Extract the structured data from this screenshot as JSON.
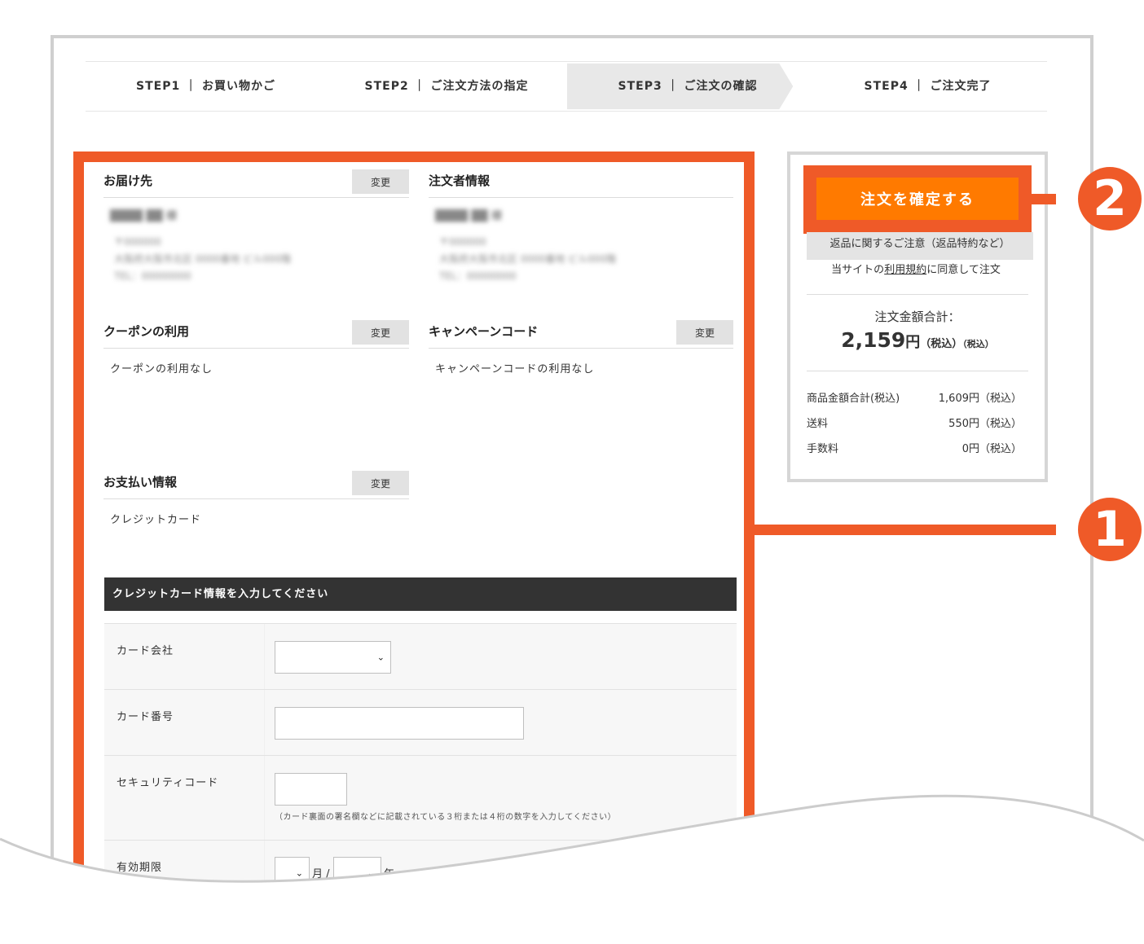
{
  "steps": [
    {
      "label": "STEP1 ｜ お買い物かご"
    },
    {
      "label": "STEP2 ｜ ご注文方法の指定"
    },
    {
      "label": "STEP3 ｜ ご注文の確認"
    },
    {
      "label": "STEP4 ｜ ご注文完了"
    }
  ],
  "sections": {
    "delivery": {
      "title": "お届け先",
      "change": "変更",
      "name": "████ ██ 様",
      "address": [
        "〒000000",
        "大阪府大阪市北区 0000番地 ビル000階",
        "TEL：00000000"
      ]
    },
    "orderer": {
      "title": "注文者情報",
      "name": "████ ██ 様",
      "address": [
        "〒000000",
        "大阪府大阪市北区 0000番地 ビル000階",
        "TEL：00000000"
      ]
    },
    "coupon": {
      "title": "クーポンの利用",
      "change": "変更",
      "value": "クーポンの利用なし"
    },
    "campaign": {
      "title": "キャンペーンコード",
      "change": "変更",
      "value": "キャンペーンコードの利用なし"
    },
    "payment": {
      "title": "お支払い情報",
      "change": "変更",
      "value": "クレジットカード"
    }
  },
  "credit_card": {
    "header": "クレジットカード情報を入力してください",
    "card_company_label": "カード会社",
    "card_number_label": "カード番号",
    "security_code_label": "セキュリティコード",
    "security_code_hint": "（カード裏面の署名欄などに記載されている３桁または４桁の数字を入力してください）",
    "expiry_label": "有効期限",
    "month_unit": "月 /",
    "year_unit": "年"
  },
  "summary": {
    "confirm_button": "注文を確定する",
    "return_note": "返品に関するご注意（返品特約など）",
    "agree_prefix": "当サイトの",
    "agree_terms": "利用規約",
    "agree_suffix": "に同意して注文",
    "total_label": "注文金額合計：",
    "total_amount": "2,159",
    "yen": "円",
    "tax1": "（税込）",
    "tax2": "（税込）",
    "lines": [
      {
        "label": "商品金額合計(税込)",
        "value": "1,609円（税込）"
      },
      {
        "label": "送料",
        "value": "550円（税込）"
      },
      {
        "label": "手数料",
        "value": "0円（税込）"
      }
    ]
  },
  "callouts": {
    "one": "1",
    "two": "2"
  },
  "colors": {
    "accent": "#ef5a28",
    "button": "#ff7a00",
    "dark_header": "#333333",
    "step_active_bg": "#e8e8e8"
  }
}
